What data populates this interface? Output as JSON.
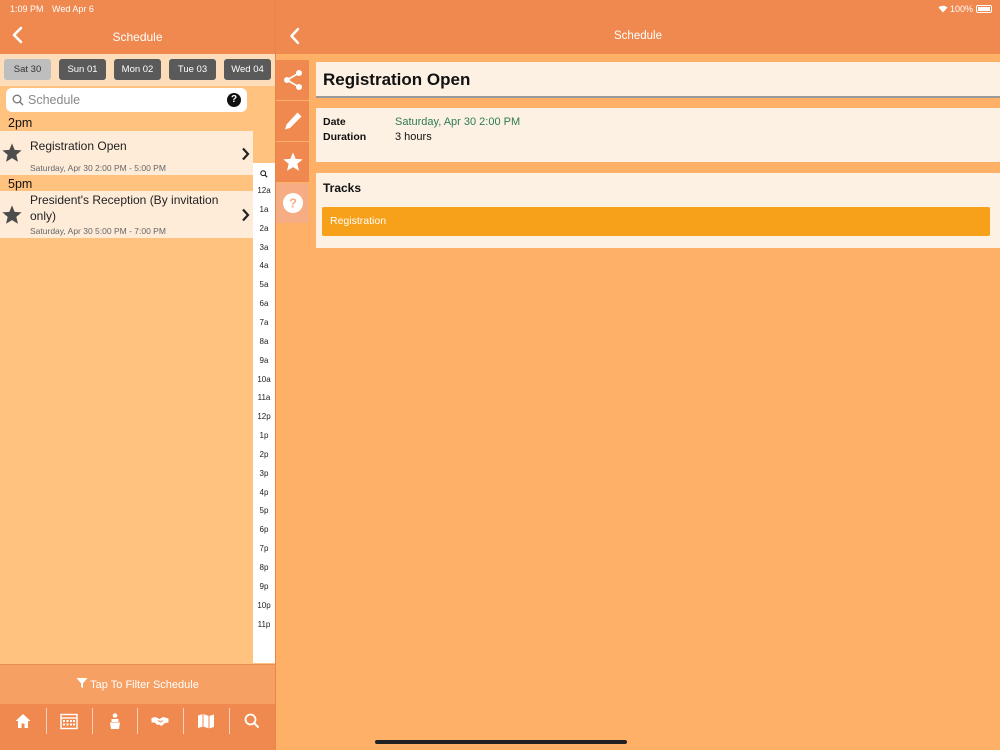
{
  "status": {
    "time": "1:09 PM",
    "date": "Wed Apr 6",
    "battery": "100%"
  },
  "left_nav": {
    "title": "Schedule"
  },
  "days": [
    {
      "label": "Sat 30",
      "selected": true
    },
    {
      "label": "Sun 01",
      "selected": false
    },
    {
      "label": "Mon 02",
      "selected": false
    },
    {
      "label": "Tue 03",
      "selected": false
    },
    {
      "label": "Wed 04",
      "selected": false
    }
  ],
  "search": {
    "placeholder": "Schedule",
    "help": "?"
  },
  "list": [
    {
      "time": "2pm",
      "title": "Registration Open",
      "subtitle": "Saturday, Apr 30 2:00 PM - 5:00 PM"
    },
    {
      "time": "5pm",
      "title": "President's Reception (By invitation only)",
      "subtitle": "Saturday, Apr 30 5:00 PM - 7:00 PM"
    }
  ],
  "time_index": [
    "12a",
    "1a",
    "2a",
    "3a",
    "4a",
    "5a",
    "6a",
    "7a",
    "8a",
    "9a",
    "10a",
    "11a",
    "12p",
    "1p",
    "2p",
    "3p",
    "4p",
    "5p",
    "6p",
    "7p",
    "8p",
    "9p",
    "10p",
    "11p"
  ],
  "filter": {
    "label": "Tap To Filter Schedule"
  },
  "tabbar": {
    "icons": [
      "home-icon",
      "calendar-icon",
      "speaker-icon",
      "handshake-icon",
      "map-icon",
      "search-icon"
    ]
  },
  "right_nav": {
    "title": "Schedule"
  },
  "detail": {
    "title": "Registration Open",
    "date_label": "Date",
    "date_value": "Saturday, Apr 30 2:00 PM",
    "duration_label": "Duration",
    "duration_value": "3 hours",
    "tracks_label": "Tracks",
    "track": "Registration"
  },
  "colors": {
    "nav": "#f0894f",
    "background": "#fdb066",
    "track": "#f7a01a",
    "date_text": "#2e7a57"
  }
}
